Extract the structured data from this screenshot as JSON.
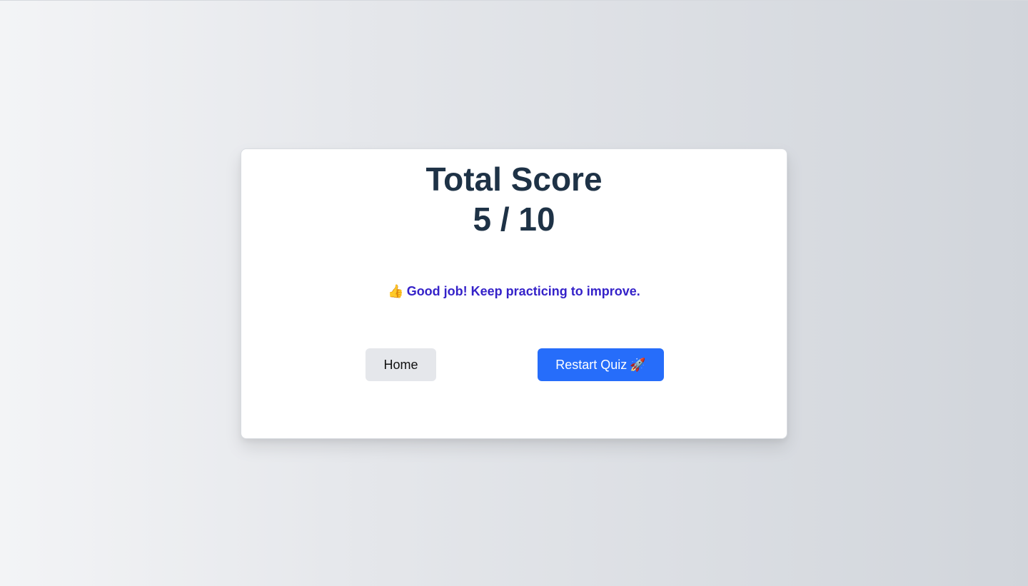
{
  "result": {
    "title": "Total Score",
    "score": "5 / 10",
    "message_icon": "👍",
    "message_icon_name": "thumbs-up-icon",
    "message": "Good job! Keep practicing to improve."
  },
  "actions": {
    "home_label": "Home",
    "restart_label": "Restart Quiz",
    "restart_icon": "🚀",
    "restart_icon_name": "rocket-icon"
  },
  "colors": {
    "title": "#1e3246",
    "message": "#3522c9",
    "primary_button": "#266dfa",
    "secondary_button": "#e5e7eb"
  }
}
